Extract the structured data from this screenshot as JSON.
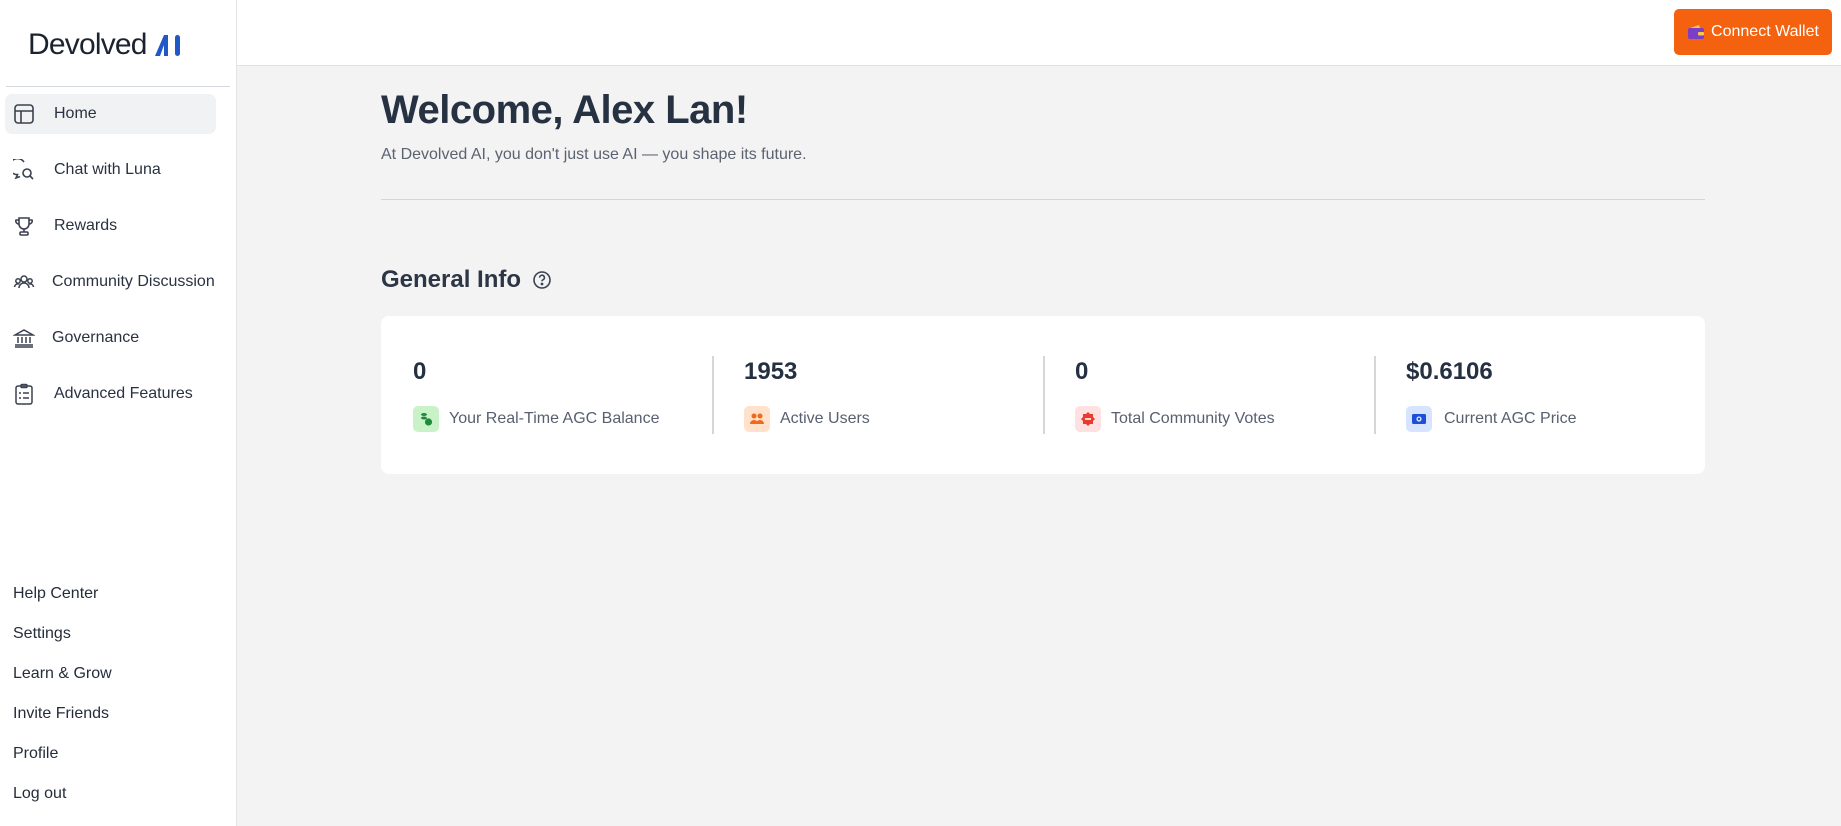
{
  "brand": {
    "name": "Devolved",
    "mark_color": "#2157c7"
  },
  "sidebar": {
    "nav_items": [
      {
        "label": "Home",
        "icon": "layout-icon",
        "active": true
      },
      {
        "label": "Chat with Luna",
        "icon": "chat-search-icon"
      },
      {
        "label": "Rewards",
        "icon": "trophy-icon"
      },
      {
        "label": "Community Discussion",
        "icon": "users-icon"
      },
      {
        "label": "Governance",
        "icon": "bank-icon"
      },
      {
        "label": "Advanced Features",
        "icon": "clipboard-list-icon"
      }
    ],
    "bottom_links": [
      {
        "label": "Help Center"
      },
      {
        "label": "Settings"
      },
      {
        "label": "Learn & Grow"
      },
      {
        "label": "Invite Friends"
      },
      {
        "label": "Profile"
      },
      {
        "label": "Log out"
      }
    ]
  },
  "topbar": {
    "connect_wallet_label": "Connect Wallet",
    "connect_wallet_color": "#f5620f"
  },
  "main": {
    "welcome_title": "Welcome, Alex Lan!",
    "welcome_subtitle": "At Devolved AI, you don't just use AI — you shape its future.",
    "section_title": "General Info",
    "stats": [
      {
        "value": "0",
        "label": "Your Real-Time AGC Balance",
        "icon": "coins-icon",
        "icon_bg": "#c9f2c8"
      },
      {
        "value": "1953",
        "label": "Active Users",
        "icon": "users-icon",
        "icon_bg": "#ffe1cc"
      },
      {
        "value": "0",
        "label": "Total Community Votes",
        "icon": "vote-badge-icon",
        "icon_bg": "#ffe1e1"
      },
      {
        "value": "$0.6106",
        "label": "Current AGC Price",
        "icon": "money-icon",
        "icon_bg": "#d6e4ff"
      }
    ]
  }
}
